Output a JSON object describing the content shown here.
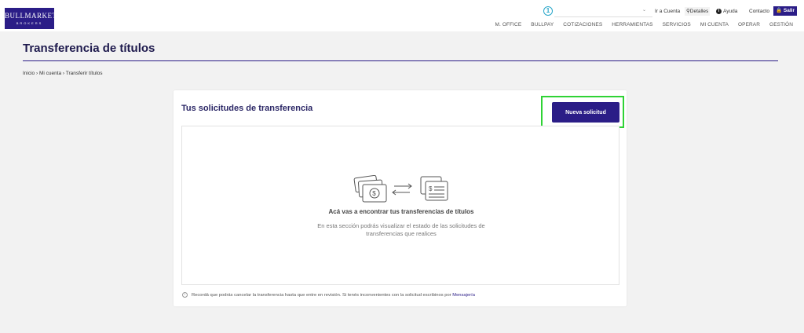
{
  "header": {
    "logo_main": "BULLMARKET",
    "logo_sub": "BROKERS",
    "notification_count": "1",
    "account_placeholder": "",
    "ir_a_cuenta": "Ir a Cuenta",
    "detalles": "Detalles",
    "ayuda": "Ayuda",
    "contacto": "Contacto",
    "salir": "Salir",
    "nav": [
      "M. OFFICE",
      "BULLPAY",
      "COTIZACIONES",
      "HERRAMIENTAS",
      "SERVICIOS",
      "MI CUENTA",
      "OPERAR",
      "GESTIÓN"
    ]
  },
  "page": {
    "title": "Transferencia de títulos",
    "breadcrumb": "Inicio › Mi cuenta › Transferir títulos"
  },
  "card": {
    "title": "Tus solicitudes de transferencia",
    "new_button": "Nueva solicitud",
    "empty_heading": "Acá vas a encontrar tus transferencias de títulos",
    "empty_description": "En esta sección podrás visualizar el estado de las solicitudes de transferencias que realices",
    "footer_text": "Recordá que podrás cancelar la transferencia hasta que entre en revisión. Si tenés inconvenientes con la solicitud escribinos por",
    "footer_link": "Mensajería"
  },
  "colors": {
    "brand": "#2b1d87",
    "highlight": "#2fd335",
    "badge": "#2aa7c9"
  }
}
